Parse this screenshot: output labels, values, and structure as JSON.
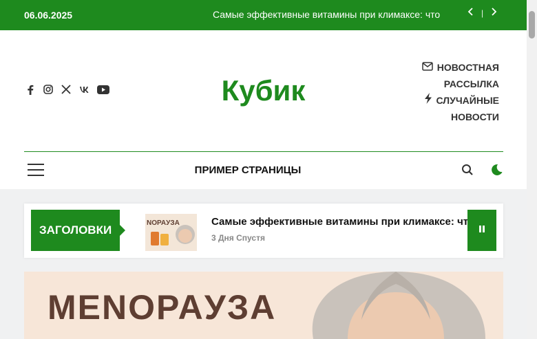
{
  "topbar": {
    "date": "06.06.2025",
    "ticker": "Самые эффективные витамины при климаксе: что",
    "separator": "|"
  },
  "site": {
    "title": "Кубик"
  },
  "header_links": [
    {
      "label_line1": "НОВОСТНАЯ",
      "label_line2": "РАССЫЛКА",
      "icon": "envelope-icon"
    },
    {
      "label_line1": "СЛУЧАЙНЫЕ",
      "label_line2": "НОВОСТИ",
      "icon": "bolt-icon"
    }
  ],
  "social": [
    "facebook-icon",
    "instagram-icon",
    "x-icon",
    "vk-icon",
    "youtube-icon"
  ],
  "menu": {
    "title": "ПРИМЕР СТРАНИЦЫ"
  },
  "headlines": {
    "badge": "ЗАГОЛОВКИ",
    "item_title": "Самые эффективные витамины при климаксе: что",
    "item_time": "3 Дня Спустя",
    "thumb_text": "NOPAУЗА"
  },
  "hero": {
    "text": "MENOPAУЗА"
  },
  "colors": {
    "accent": "#1e8a1e",
    "hero_bg": "#f7e6d8",
    "hero_text": "#5e3e32"
  }
}
